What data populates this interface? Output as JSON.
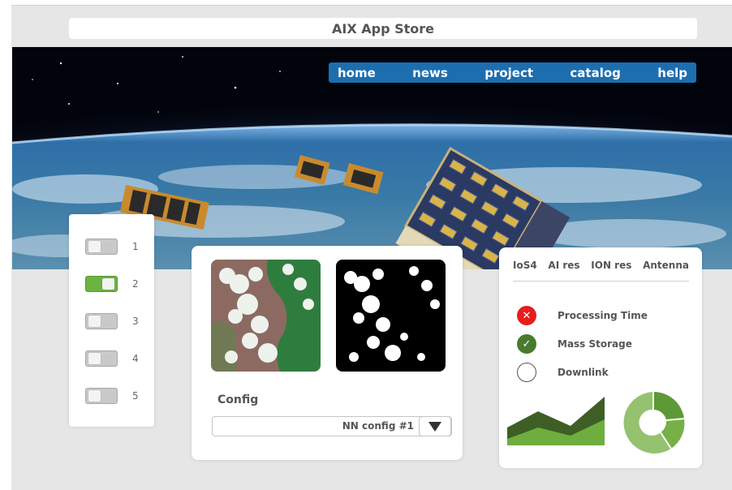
{
  "app": {
    "title": "AIX App Store"
  },
  "nav": {
    "items": [
      "home",
      "news",
      "project",
      "catalog",
      "help"
    ]
  },
  "toggles": {
    "items": [
      {
        "label": "1",
        "on": false
      },
      {
        "label": "2",
        "on": true
      },
      {
        "label": "3",
        "on": false
      },
      {
        "label": "4",
        "on": false
      },
      {
        "label": "5",
        "on": false
      }
    ]
  },
  "config": {
    "label": "Config",
    "selected": "NN config #1"
  },
  "status": {
    "tabs": [
      "IoS4",
      "AI res",
      "ION res",
      "Antenna"
    ],
    "items": [
      {
        "label": "Processing Time",
        "state": "error",
        "icon": "x-icon"
      },
      {
        "label": "Mass Storage",
        "state": "ok",
        "icon": "check-icon"
      },
      {
        "label": "Downlink",
        "state": "pending",
        "icon": "empty-circle-icon"
      }
    ]
  },
  "colors": {
    "nav": "#1d6eaf",
    "toggle_on": "#6cb33f",
    "error": "#e41e1e",
    "ok": "#4a7a30",
    "chart_dark": "#3e5e26",
    "chart_light": "#6fae3e",
    "donut_light": "#94c26e"
  }
}
